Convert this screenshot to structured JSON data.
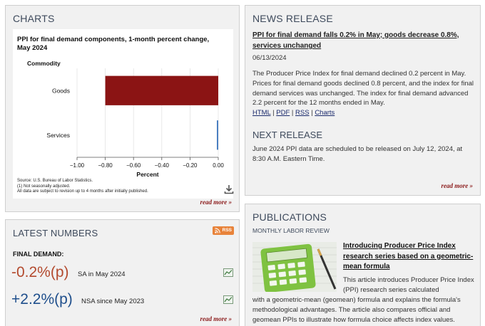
{
  "charts": {
    "heading": "CHARTS",
    "read_more": "read more »",
    "source_lines": [
      "Source: U.S. Bureau of Labor Statistics.",
      "(1) Not seasonally adjusted.",
      "All data are subject to revision up to 4 months after initially published."
    ]
  },
  "chart_data": {
    "type": "bar",
    "orientation": "horizontal",
    "title": "PPI for final demand components, 1-month percent change, May 2024",
    "ylabel": "Commodity",
    "xlabel": "Percent",
    "categories": [
      "Goods",
      "Services"
    ],
    "values": [
      -0.8,
      0.0
    ],
    "xlim": [
      -1.0,
      0.0
    ],
    "xticks": [
      "−1.00",
      "−0.80",
      "−0.60",
      "−0.40",
      "−0.20",
      "0.00"
    ],
    "grid": true,
    "colors": {
      "Goods": "#8b1414",
      "Services": "#4a7fc1"
    }
  },
  "latest": {
    "heading": "LATEST NUMBERS",
    "rss_label": "RSS",
    "final_demand_label": "FINAL DEMAND:",
    "stats": [
      {
        "value": "-0.2%(p)",
        "desc": "SA in May 2024",
        "color": "#b34a2e"
      },
      {
        "value": "+2.2%(p)",
        "desc": "NSA since May 2023",
        "color": "#1f4f8c"
      }
    ],
    "read_more": "read more »"
  },
  "news": {
    "heading": "NEWS RELEASE",
    "headline": "PPI for final demand falls 0.2% in May; goods decrease 0.8%, services unchanged",
    "date": "06/13/2024",
    "body": "The Producer Price Index for final demand declined 0.2 percent in May. Prices for final demand goods declined 0.8 percent, and the index for final demand services was unchanged. The index for final demand advanced 2.2 percent for the 12 months ended in May.",
    "links": [
      "HTML",
      "PDF",
      "RSS",
      "Charts"
    ],
    "separator": "|",
    "next_heading": "NEXT RELEASE",
    "next_body": "June 2024 PPI data are scheduled to be released on July 12, 2024, at 8:30 A.M. Eastern Time.",
    "read_more": "read more »"
  },
  "publications": {
    "heading": "PUBLICATIONS",
    "section": "MONTHLY LABOR REVIEW",
    "title": "Introducing Producer Price Index research series based on a geometric-mean formula",
    "body_indented": "This article introduces Producer Price Index (PPI) research series calculated",
    "body_rest": "with a geometric-mean (geomean) formula and explains the formula's methodological advantages. The article also compares official and geomean PPIs to illustrate how formula choice affects index values."
  }
}
